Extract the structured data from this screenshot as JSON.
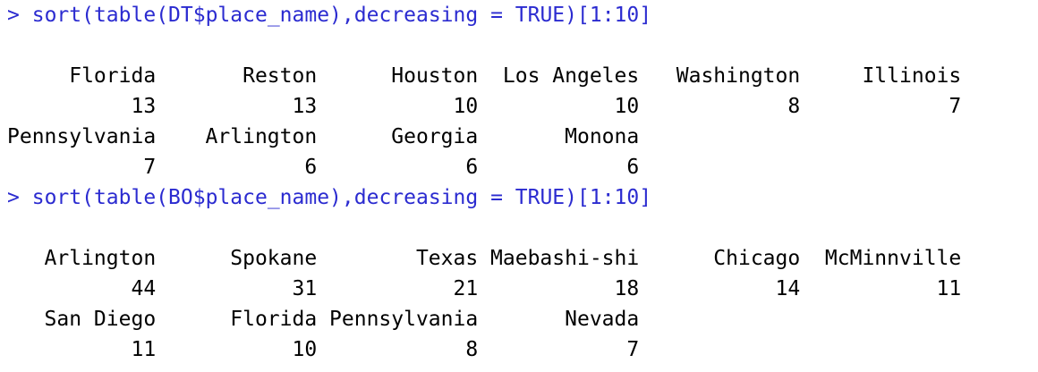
{
  "console": {
    "prompt": ">",
    "blocks": [
      {
        "command": "sort(table(DT$place_name),decreasing = TRUE)[1:10]",
        "output_lines": [
          "     Florida       Reston      Houston  Los Angeles   Washington     Illinois",
          "          13           13           10           10            8            7",
          "Pennsylvania    Arlington      Georgia       Monona",
          "           7            6            6            6"
        ]
      },
      {
        "command": "sort(table(BO$place_name),decreasing = TRUE)[1:10]",
        "output_lines": [
          "   Arlington      Spokane        Texas Maebashi-shi      Chicago  McMinnville",
          "          44           31           21           18           14           11",
          "   San Diego      Florida Pennsylvania       Nevada",
          "          11           10            8            7"
        ]
      }
    ]
  }
}
